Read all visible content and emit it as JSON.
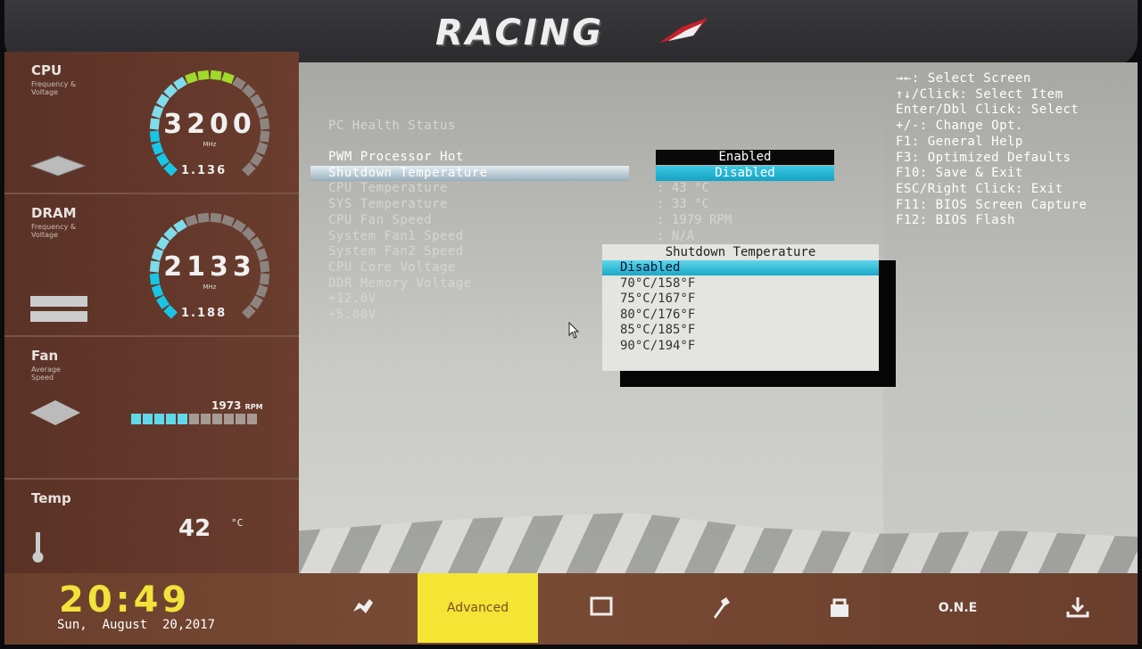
{
  "header": {
    "logo": "RACING"
  },
  "sidebar": {
    "cpu": {
      "title": "CPU",
      "subtitle": "Frequency & Voltage",
      "freq": "3200",
      "unit": "MHz",
      "voltage": "1.136",
      "gauge_segments": 22,
      "gauge_lit_cyan": 9,
      "gauge_lit_green": 4
    },
    "dram": {
      "title": "DRAM",
      "subtitle": "Frequency & Voltage",
      "freq": "2133",
      "unit": "MHz",
      "voltage": "1.188",
      "gauge_segments": 22,
      "gauge_lit_cyan": 9,
      "gauge_lit_green": 0
    },
    "fan": {
      "title": "Fan",
      "subtitle": "Average Speed",
      "rpm": "1973",
      "unit": "RPM",
      "bar_segments": 11,
      "bar_lit": 5
    },
    "temp": {
      "title": "Temp",
      "value": "42",
      "unit": "°C"
    }
  },
  "main": {
    "section_title": "PC Health Status",
    "rows": [
      {
        "label": "PWM Processor Hot",
        "value": "Enabled"
      },
      {
        "label": "Shutdown Temperature",
        "value": "Disabled"
      },
      {
        "label": "CPU Temperature",
        "value": ": 43 °C"
      },
      {
        "label": "SYS Temperature",
        "value": ": 33 °C"
      },
      {
        "label": "CPU Fan Speed",
        "value": ": 1979 RPM"
      },
      {
        "label": "System Fan1 Speed",
        "value": ": N/A"
      },
      {
        "label": "System Fan2 Speed",
        "value": ""
      },
      {
        "label": "CPU Core Voltage",
        "value": ""
      },
      {
        "label": "DDR Memory Voltage",
        "value": ""
      },
      {
        "label": "+12.0V",
        "value": ""
      },
      {
        "label": "+5.00V",
        "value": ""
      }
    ],
    "popup": {
      "title": "Shutdown Temperature",
      "options": [
        "Disabled",
        "70°C/158°F",
        "75°C/167°F",
        "80°C/176°F",
        "85°C/185°F",
        "90°C/194°F"
      ],
      "selected": "Disabled"
    }
  },
  "help": [
    "→←: Select Screen",
    "↑↓/Click: Select Item",
    "Enter/Dbl Click: Select",
    "+/-: Change Opt.",
    "F1: General Help",
    "F3: Optimized Defaults",
    "F10: Save & Exit",
    "ESC/Right Click: Exit",
    "F11: BIOS Screen Capture",
    "F12: BIOS Flash"
  ],
  "footer": {
    "time": "20:49",
    "date": "Sun,  August  20,2017",
    "tabs": [
      {
        "name": "main",
        "icon": "flag-icon"
      },
      {
        "name": "advanced",
        "label": "Advanced"
      },
      {
        "name": "chipset",
        "icon": "chip-icon"
      },
      {
        "name": "tools",
        "icon": "wrench-icon"
      },
      {
        "name": "security",
        "icon": "lock-icon"
      },
      {
        "name": "one",
        "label": "O.N.E"
      },
      {
        "name": "save",
        "icon": "download-icon"
      }
    ],
    "active_tab": "Advanced"
  },
  "colors": {
    "accent_cyan": "#1fb7d6",
    "accent_yellow": "#f4e434",
    "brown": "#6a3d2e",
    "gauge_green": "#9fd92a"
  }
}
